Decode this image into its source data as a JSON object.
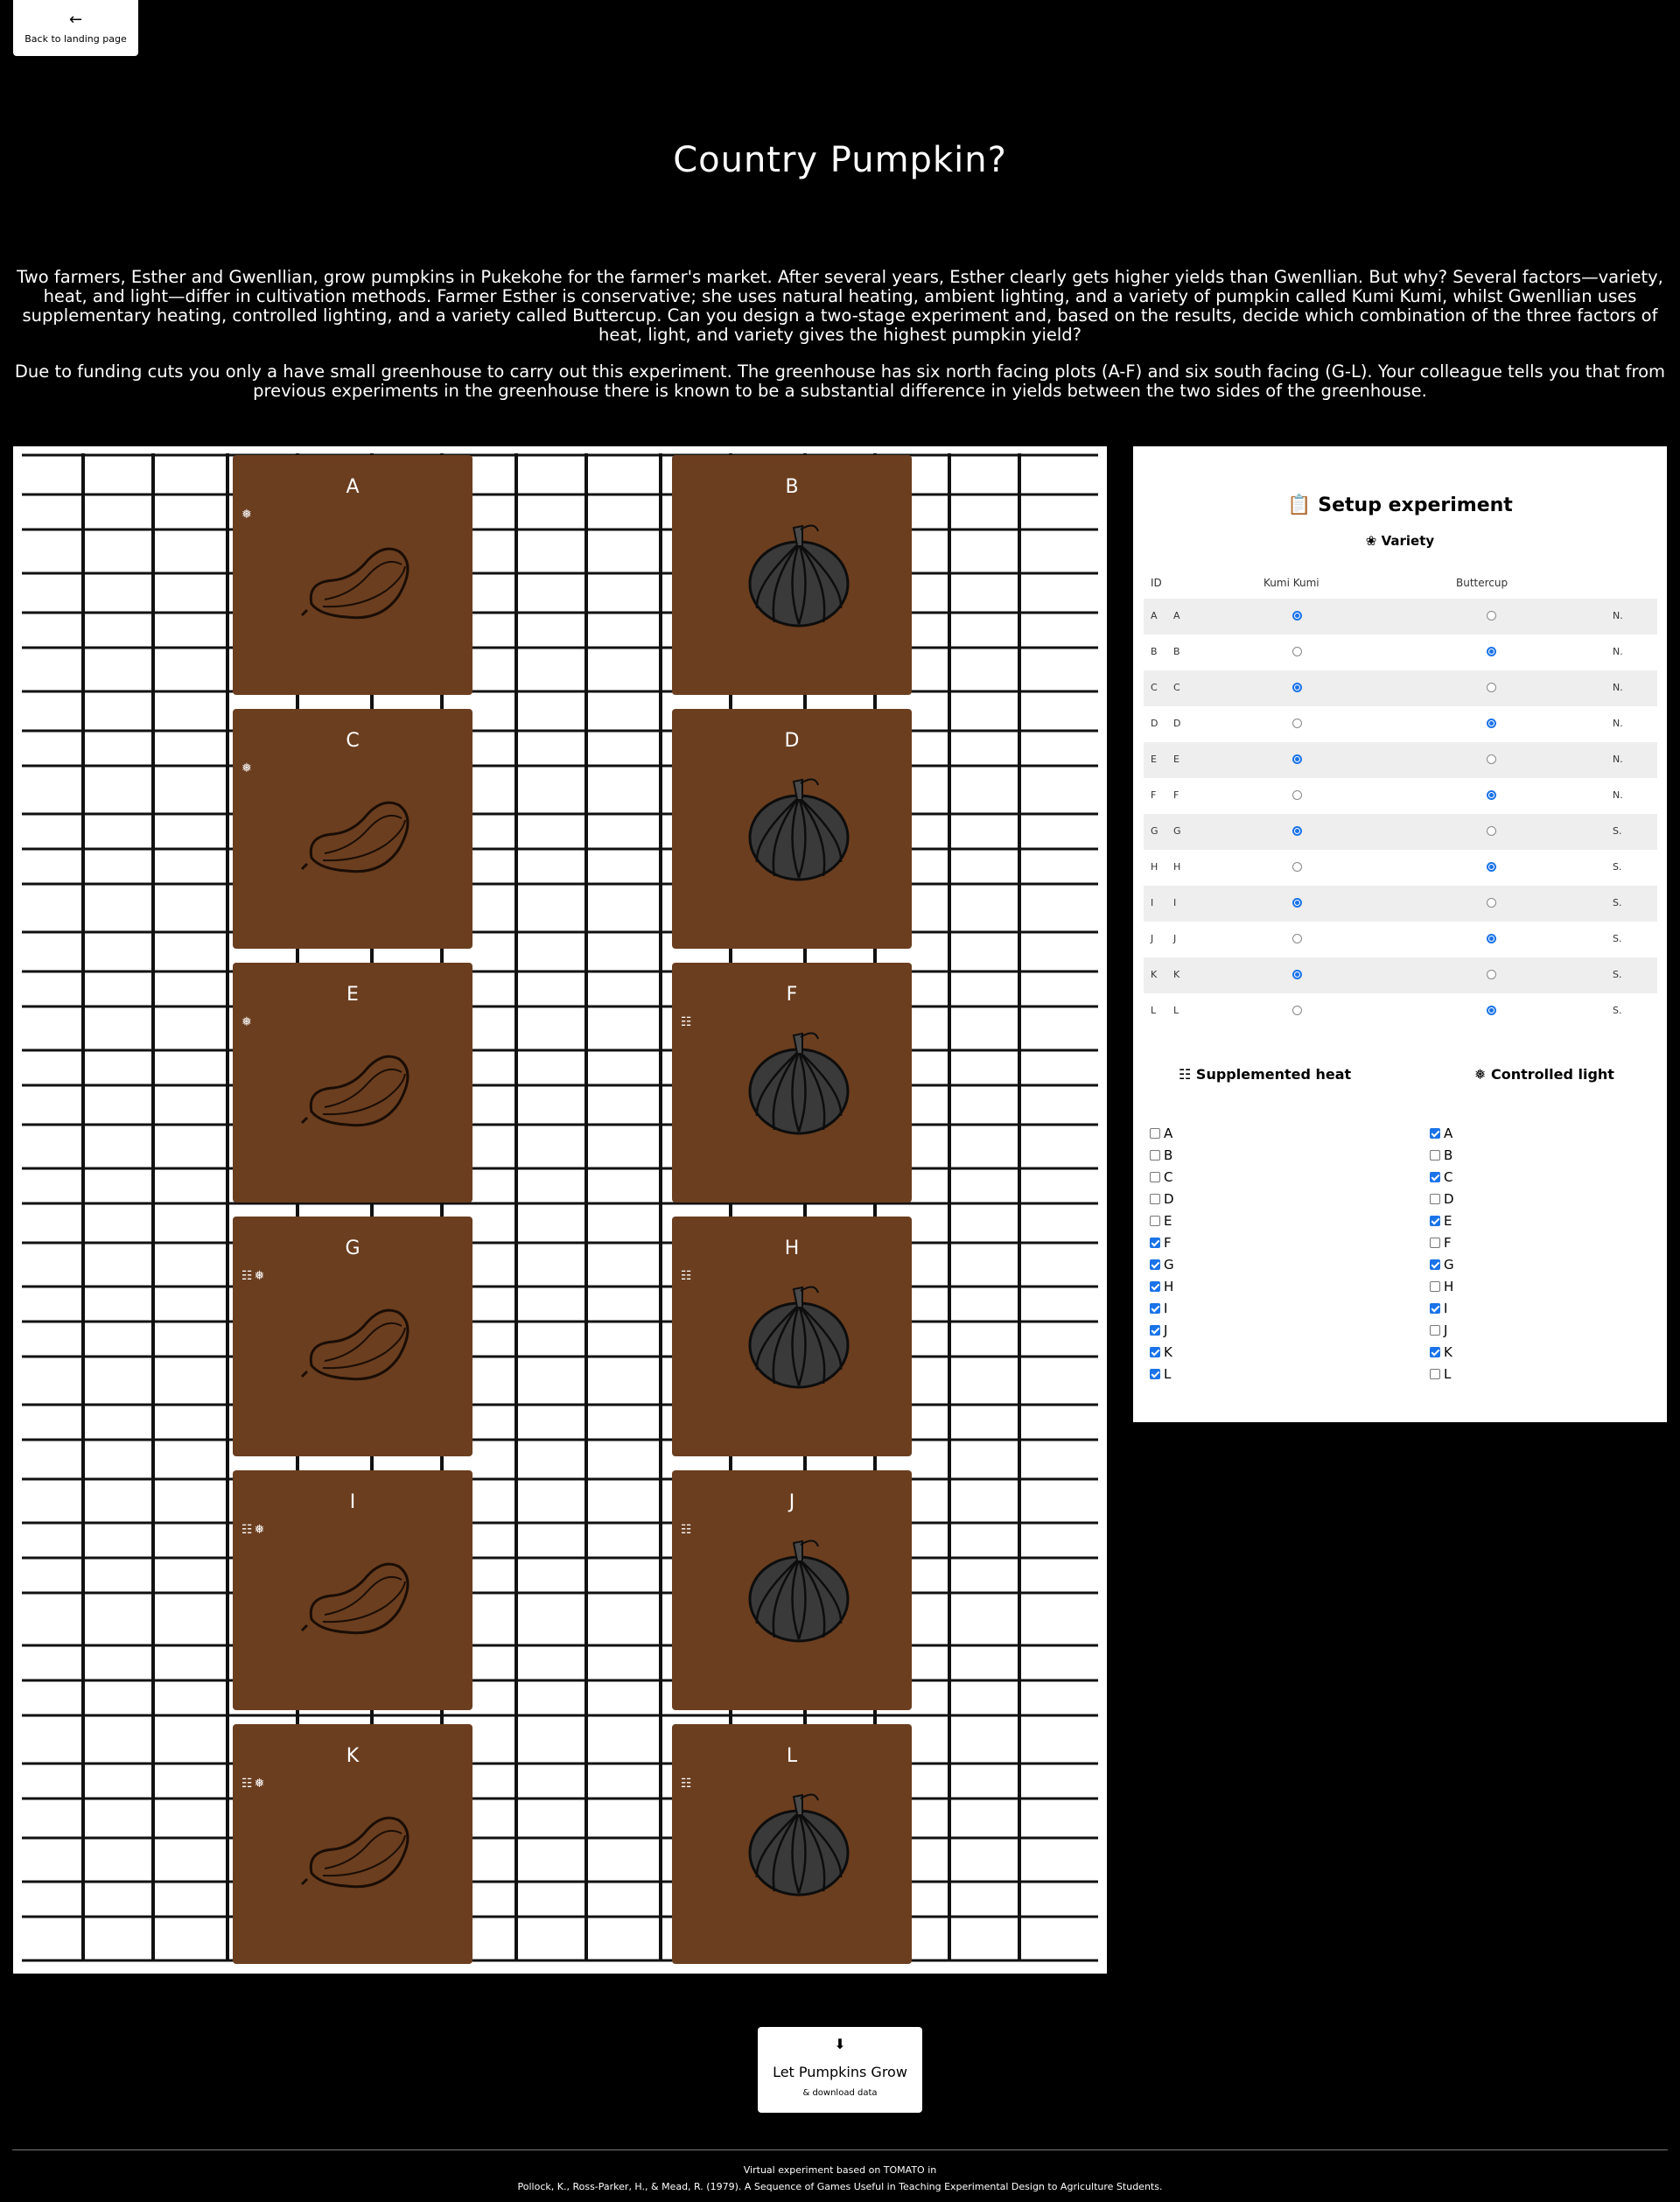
{
  "nav": {
    "back_label": "Back to landing page"
  },
  "title": "Country Pumpkin?",
  "intro": {
    "p1": "Two farmers, Esther and Gwenllian, grow pumpkins in Pukekohe for the farmer's market. After several years, Esther clearly gets higher yields than Gwenllian. But why? Several factors—variety, heat, and light—differ in cultivation methods. Farmer Esther is conservative; she uses natural heating, ambient lighting, and a variety of pumpkin called Kumi Kumi, whilst Gwenllian uses supplementary heating, controlled lighting, and a variety called Buttercup. Can you design a two-stage experiment and, based on the results, decide which combination of the three factors of heat, light, and variety gives the highest pumpkin yield?",
    "p2": "Due to funding cuts you only a have small greenhouse to carry out this experiment. The greenhouse has six north facing plots (A-F) and six south facing (G-L). Your colleague tells you that from previous experiments in the greenhouse there is known to be a substantial difference in yields between the two sides of the greenhouse."
  },
  "plots": [
    {
      "id": "A",
      "variety": "kumi",
      "icons": "❅"
    },
    {
      "id": "B",
      "variety": "buttercup",
      "icons": ""
    },
    {
      "id": "C",
      "variety": "kumi",
      "icons": "❅"
    },
    {
      "id": "D",
      "variety": "buttercup",
      "icons": ""
    },
    {
      "id": "E",
      "variety": "kumi",
      "icons": "❅"
    },
    {
      "id": "F",
      "variety": "buttercup",
      "icons": "☷"
    },
    {
      "id": "G",
      "variety": "kumi",
      "icons": "☷❅"
    },
    {
      "id": "H",
      "variety": "buttercup",
      "icons": "☷"
    },
    {
      "id": "I",
      "variety": "kumi",
      "icons": "☷❅"
    },
    {
      "id": "J",
      "variety": "buttercup",
      "icons": "☷"
    },
    {
      "id": "K",
      "variety": "kumi",
      "icons": "☷❅"
    },
    {
      "id": "L",
      "variety": "buttercup",
      "icons": "☷"
    }
  ],
  "panel": {
    "title_icon": "clipboard-icon",
    "title": "Setup experiment",
    "variety_icon": "sprout-icon",
    "variety_title": "Variety",
    "headers": {
      "id": "ID",
      "kumi": "Kumi Kumi",
      "buttercup": "Buttercup"
    },
    "rows": [
      {
        "id": "A",
        "label": "A",
        "variety": "kumi",
        "side": "N."
      },
      {
        "id": "B",
        "label": "B",
        "variety": "buttercup",
        "side": "N."
      },
      {
        "id": "C",
        "label": "C",
        "variety": "kumi",
        "side": "N."
      },
      {
        "id": "D",
        "label": "D",
        "variety": "buttercup",
        "side": "N."
      },
      {
        "id": "E",
        "label": "E",
        "variety": "kumi",
        "side": "N."
      },
      {
        "id": "F",
        "label": "F",
        "variety": "buttercup",
        "side": "N."
      },
      {
        "id": "G",
        "label": "G",
        "variety": "kumi",
        "side": "S."
      },
      {
        "id": "H",
        "label": "H",
        "variety": "buttercup",
        "side": "S."
      },
      {
        "id": "I",
        "label": "I",
        "variety": "kumi",
        "side": "S."
      },
      {
        "id": "J",
        "label": "J",
        "variety": "buttercup",
        "side": "S."
      },
      {
        "id": "K",
        "label": "K",
        "variety": "kumi",
        "side": "S."
      },
      {
        "id": "L",
        "label": "L",
        "variety": "buttercup",
        "side": "S."
      }
    ],
    "heat_icon": "heater-icon",
    "heat_title": "Supplemented heat",
    "light_icon": "light-icon",
    "light_title": "Controlled light",
    "heat": [
      {
        "id": "A",
        "checked": false
      },
      {
        "id": "B",
        "checked": false
      },
      {
        "id": "C",
        "checked": false
      },
      {
        "id": "D",
        "checked": false
      },
      {
        "id": "E",
        "checked": false
      },
      {
        "id": "F",
        "checked": true
      },
      {
        "id": "G",
        "checked": true
      },
      {
        "id": "H",
        "checked": true
      },
      {
        "id": "I",
        "checked": true
      },
      {
        "id": "J",
        "checked": true
      },
      {
        "id": "K",
        "checked": true
      },
      {
        "id": "L",
        "checked": true
      }
    ],
    "light": [
      {
        "id": "A",
        "checked": true
      },
      {
        "id": "B",
        "checked": false
      },
      {
        "id": "C",
        "checked": true
      },
      {
        "id": "D",
        "checked": false
      },
      {
        "id": "E",
        "checked": true
      },
      {
        "id": "F",
        "checked": false
      },
      {
        "id": "G",
        "checked": true
      },
      {
        "id": "H",
        "checked": false
      },
      {
        "id": "I",
        "checked": true
      },
      {
        "id": "J",
        "checked": false
      },
      {
        "id": "K",
        "checked": true
      },
      {
        "id": "L",
        "checked": false
      }
    ]
  },
  "grow": {
    "icon": "download-icon",
    "label": "Let Pumpkins Grow",
    "sub": "& download data"
  },
  "footer": {
    "line1": "Virtual experiment based on TOMATO in",
    "line2": "Pollock, K., Ross-Parker, H., & Mead, R. (1979). A Sequence of Games Useful in Teaching Experimental Design to Agriculture Students."
  },
  "colors": {
    "soil": "#6b3e1f",
    "accent": "#1a73e8",
    "background": "#000000"
  }
}
